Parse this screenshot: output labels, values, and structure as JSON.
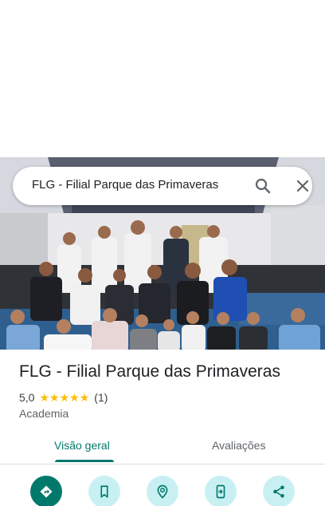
{
  "search": {
    "query": "FLG - Filial Parque das Primaveras"
  },
  "place": {
    "name": "FLG - Filial Parque das Primaveras",
    "rating": "5,0",
    "stars": 5,
    "review_count": "(1)",
    "category": "Academia"
  },
  "tabs": [
    {
      "label": "Visão geral",
      "selected": true
    },
    {
      "label": "Avaliações",
      "selected": false
    }
  ],
  "actions": [
    {
      "icon": "directions-icon"
    },
    {
      "icon": "bookmark-icon"
    },
    {
      "icon": "nearby-icon"
    },
    {
      "icon": "send-to-phone-icon"
    },
    {
      "icon": "share-icon"
    }
  ],
  "colors": {
    "accent": "#00796b",
    "action_bg": "#c8f0f2",
    "star": "#fbbc04",
    "mat_blue": "#2f5f8f"
  }
}
